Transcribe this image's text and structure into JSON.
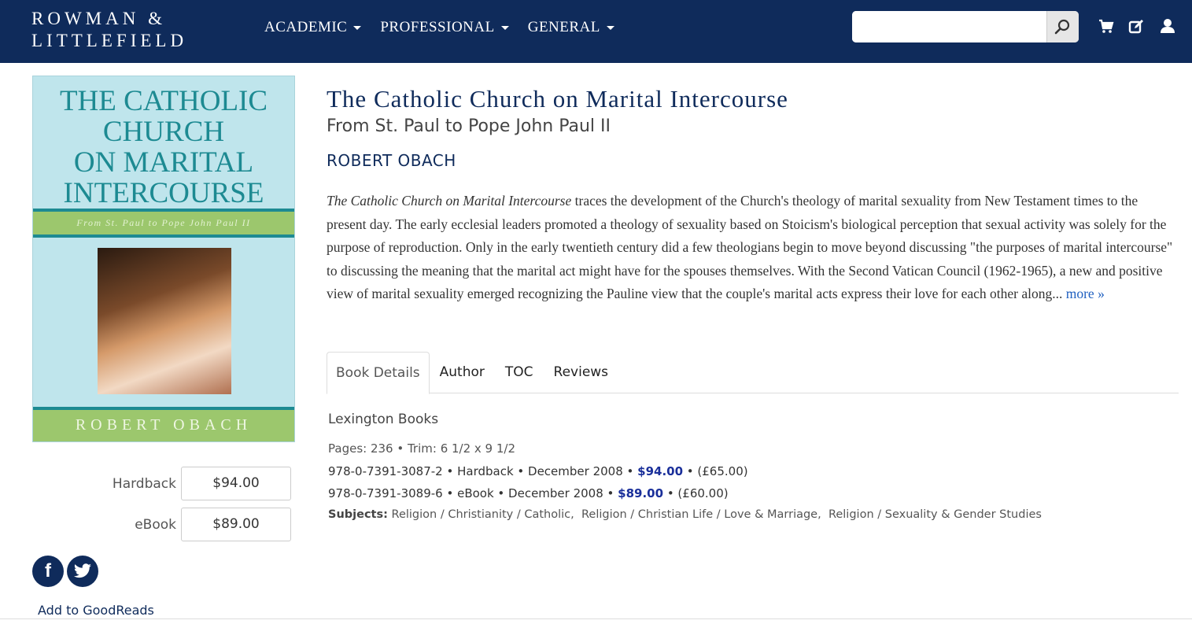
{
  "header": {
    "logo_line1": "ROWMAN &",
    "logo_line2": "LITTLEFIELD",
    "nav": [
      "ACADEMIC",
      "PROFESSIONAL",
      "GENERAL"
    ],
    "search": {
      "value": "",
      "placeholder": ""
    },
    "icons": [
      "search-icon",
      "cart-icon",
      "edit-icon",
      "user-icon"
    ],
    "bg_color": "#0f2b5b"
  },
  "cover": {
    "title_line1": "THE CATHOLIC",
    "title_line2": "CHURCH",
    "title_line3": "ON MARITAL",
    "title_line4": "INTERCOURSE",
    "subtitle": "From St. Paul to Pope John Paul II",
    "author": "ROBERT OBACH"
  },
  "formats": [
    {
      "label": "Hardback",
      "price": "$94.00"
    },
    {
      "label": "eBook",
      "price": "$89.00"
    }
  ],
  "social": {
    "facebook": "f",
    "goodreads_label": "Add to GoodReads"
  },
  "book": {
    "title": "The Catholic Church on Marital Intercourse",
    "subtitle": "From St. Paul to Pope John Paul II",
    "author": "ROBERT OBACH",
    "description_title": "The Catholic Church on Marital Intercourse",
    "description_rest": " traces the development of the Church's theology of marital sexuality from New Testament times to the present day. The early ecclesial leaders promoted a theology of sexuality based on Stoicism's biological perception that sexual activity was solely for the purpose of reproduction. Only in the early twentieth century did a few theologians begin to move beyond discussing \"the purposes of marital intercourse\" to discussing the meaning that the marital act might have for the spouses themselves. With the Second Vatican Council (1962-1965), a new and positive view of marital sexuality emerged recognizing the Pauline view that the couple's marital acts express their love for each other along...",
    "more_label": "more »"
  },
  "tabs": [
    "Book Details",
    "Author",
    "TOC",
    "Reviews"
  ],
  "details": {
    "publisher": "Lexington Books",
    "pages_trim": "Pages: 236 • Trim: 6 1/2 x 9 1/2",
    "editions": [
      {
        "prefix": "978-0-7391-3087-2 • Hardback • December 2008 • ",
        "price": "$94.00",
        "suffix": " • (£65.00)"
      },
      {
        "prefix": "978-0-7391-3089-6 • eBook • December 2008 • ",
        "price": "$89.00",
        "suffix": " • (£60.00)"
      }
    ],
    "subjects_label": "Subjects:",
    "subjects": [
      "Religion / Christianity / Catholic,",
      "Religion / Christian Life / Love & Marriage,",
      "Religion / Sexuality & Gender Studies"
    ]
  }
}
